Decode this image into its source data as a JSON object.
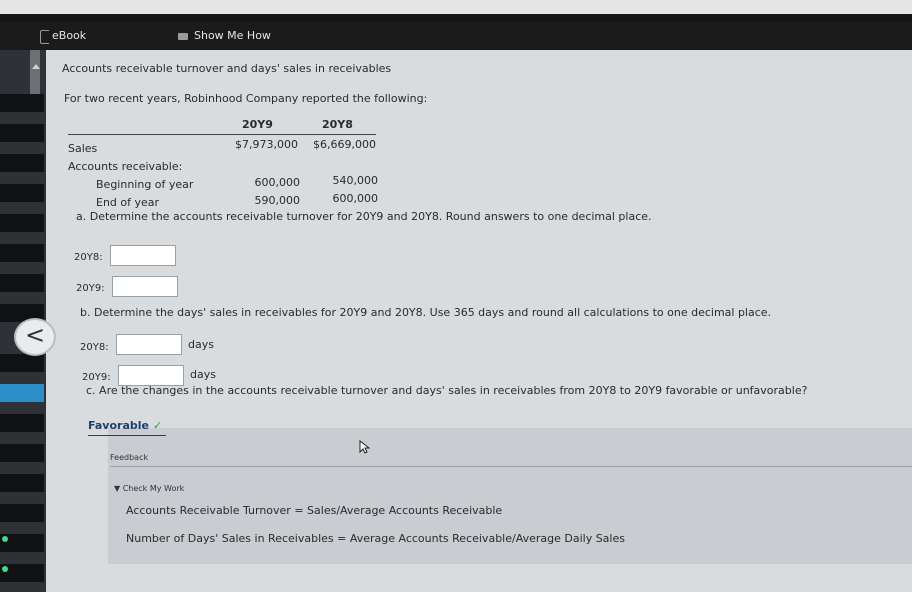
{
  "tabs": {
    "ebook": "eBook",
    "show_me_how": "Show Me How"
  },
  "problem": {
    "heading": "Accounts receivable turnover and days' sales in receivables",
    "intro": "For two recent years, Robinhood Company reported the following:",
    "columns": [
      "20Y9",
      "20Y8"
    ],
    "rows": {
      "sales": {
        "label": "Sales",
        "y9": "$7,973,000",
        "y8": "$6,669,000"
      },
      "ar_header": "Accounts receivable:",
      "beginning": {
        "label": "Beginning of year",
        "y9": "600,000",
        "y8": "540,000"
      },
      "end": {
        "label": "End of year",
        "y9": "590,000",
        "y8": "600,000"
      }
    }
  },
  "part_a": {
    "question": "a. Determine the accounts receivable turnover for 20Y9 and 20Y8. Round answers to one decimal place.",
    "label_20y8": "20Y8:",
    "label_20y9": "20Y9:",
    "value_20y8": "",
    "value_20y9": ""
  },
  "part_b": {
    "question": "b. Determine the days' sales in receivables for 20Y9 and 20Y8. Use 365 days and round all calculations to one decimal place.",
    "label_20y8": "20Y8:",
    "label_20y9": "20Y9:",
    "value_20y8": "",
    "value_20y9": "",
    "unit": "days"
  },
  "part_c": {
    "question": "c. Are the changes in the accounts receivable turnover and days' sales in receivables from 20Y8 to 20Y9 favorable or unfavorable?",
    "answer": "Favorable",
    "check": "✓"
  },
  "feedback": {
    "header": "Feedback",
    "check_my_work": "▼ Check My Work",
    "line1": "Accounts Receivable Turnover = Sales/Average Accounts Receivable",
    "line2": "Number of Days' Sales in Receivables = Average Accounts Receivable/Average Daily Sales"
  },
  "nav": {
    "back": "<"
  },
  "colors": {
    "answer": "#1f3f6f",
    "check": "#2a9c3a",
    "rail_active": "#2d8fc7"
  }
}
